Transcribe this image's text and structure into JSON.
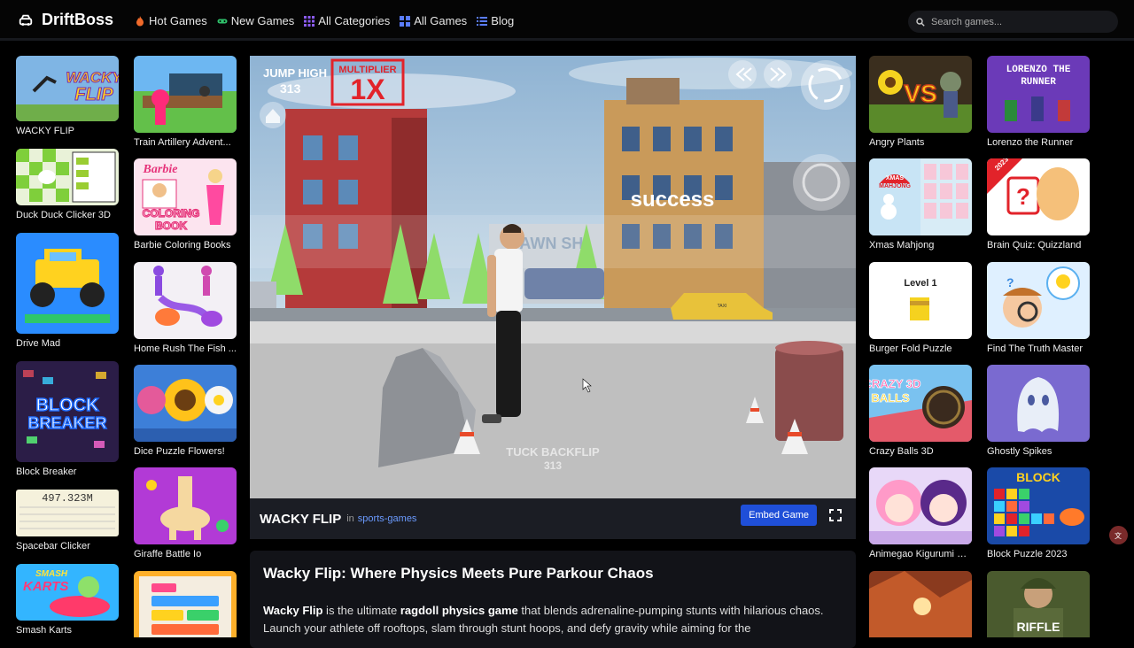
{
  "brand": {
    "name": "DriftBoss"
  },
  "nav": [
    {
      "label": "Hot Games",
      "icon": "fire-icon"
    },
    {
      "label": "New Games",
      "icon": "gamepad-icon"
    },
    {
      "label": "All Categories",
      "icon": "grid-icon"
    },
    {
      "label": "All Games",
      "icon": "apps-icon"
    },
    {
      "label": "Blog",
      "icon": "list-icon"
    }
  ],
  "search": {
    "placeholder": "Search games..."
  },
  "left_col1": [
    {
      "title": "WACKY FLIP",
      "thumb_text": "WACKY FLIP"
    },
    {
      "title": "Duck Duck Clicker 3D"
    },
    {
      "title": "Drive Mad"
    },
    {
      "title": "Block Breaker",
      "thumb_text": "BLOCK BREAKER"
    },
    {
      "title": "Spacebar Clicker",
      "thumb_text": "497.323M"
    },
    {
      "title": "Smash Karts",
      "thumb_text": "SMASH KARTS"
    }
  ],
  "left_col2": [
    {
      "title": "Train Artillery Advent..."
    },
    {
      "title": "Barbie Coloring Books",
      "thumb_text": "COLORING BOOK"
    },
    {
      "title": "Home Rush The Fish ..."
    },
    {
      "title": "Dice Puzzle Flowers!"
    },
    {
      "title": "Giraffe Battle Io"
    },
    {
      "title": ""
    }
  ],
  "right_col1": [
    {
      "title": "Angry Plants",
      "thumb_text": "VS"
    },
    {
      "title": "Xmas Mahjong",
      "thumb_text": "XMAS MAHJONG"
    },
    {
      "title": "Burger Fold Puzzle",
      "thumb_text": "Level 1"
    },
    {
      "title": "Crazy Balls 3D",
      "thumb_text": "CRAZY 3D BALLS"
    },
    {
      "title": "Animegao Kigurumi D..."
    },
    {
      "title": ""
    }
  ],
  "right_col2": [
    {
      "title": "Lorenzo the Runner",
      "thumb_text": "LORENZO THE RUNNER"
    },
    {
      "title": "Brain Quiz: Quizzland",
      "thumb_text": "2023"
    },
    {
      "title": "Find The Truth Master"
    },
    {
      "title": "Ghostly Spikes"
    },
    {
      "title": "Block Puzzle 2023",
      "thumb_text": "BLOCK"
    },
    {
      "title": "",
      "thumb_text": "RIFFLE"
    }
  ],
  "game": {
    "hud_jump": "JUMP HIGH",
    "hud_score": "313",
    "multiplier_label": "MULTIPLIER",
    "multiplier": "1X",
    "success": "success",
    "trick": "TUCK BACKFLIP",
    "trick_score": "313",
    "shop_sign": "PAWN SH",
    "taxi_sign": "TAXI",
    "title": "WACKY FLIP",
    "in": "in",
    "category": "sports-games",
    "embed": "Embed Game"
  },
  "description": {
    "heading": "Wacky Flip: Where Physics Meets Pure Parkour Chaos",
    "b1": "Wacky Flip",
    "t1": " is the ultimate ",
    "b2": "ragdoll physics game",
    "t2": " that blends adrenaline-pumping stunts with hilarious chaos. Launch your athlete off rooftops, slam through stunt hoops, and defy gravity while aiming for the"
  },
  "colors": {
    "accent": "#1f4fd8",
    "link": "#6b9bff"
  }
}
